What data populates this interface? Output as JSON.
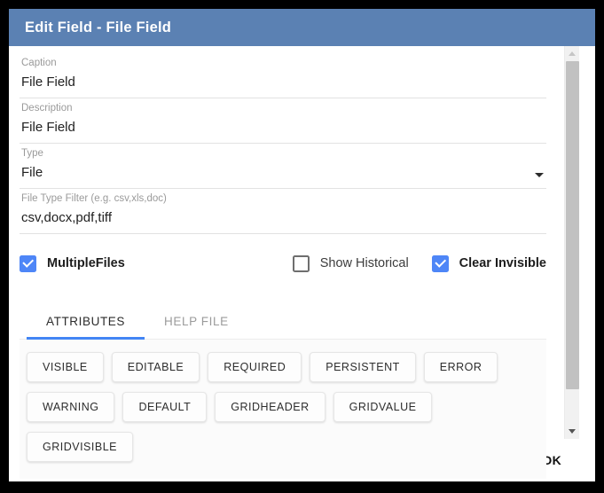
{
  "dialog": {
    "title": "Edit Field - File Field",
    "accent_color": "#4285f4",
    "titlebar_color": "#5b81b3"
  },
  "form": {
    "caption": {
      "label": "Caption",
      "value": "File Field"
    },
    "description": {
      "label": "Description",
      "value": "File Field"
    },
    "type": {
      "label": "Type",
      "value": "File",
      "caret_icon": "chevron-down-icon"
    },
    "file_type_filter": {
      "label": "File Type Filter (e.g. csv,xls,doc)",
      "value": "csv,docx,pdf,tiff"
    }
  },
  "checkboxes": [
    {
      "label": "MultipleFiles",
      "checked": true
    },
    {
      "label": "Show Historical",
      "checked": false
    },
    {
      "label": "Clear Invisible",
      "checked": true
    }
  ],
  "tabs": [
    {
      "label": "ATTRIBUTES",
      "active": true
    },
    {
      "label": "HELP FILE",
      "active": false
    }
  ],
  "attributes": [
    "VISIBLE",
    "EDITABLE",
    "REQUIRED",
    "PERSISTENT",
    "ERROR",
    "WARNING",
    "DEFAULT",
    "GRIDHEADER",
    "GRIDVALUE",
    "GRIDVISIBLE"
  ],
  "scrollbar": {
    "up_icon": "triangle-up-icon",
    "down_icon": "triangle-down-icon"
  },
  "footer": {
    "ok_label": "OK"
  }
}
